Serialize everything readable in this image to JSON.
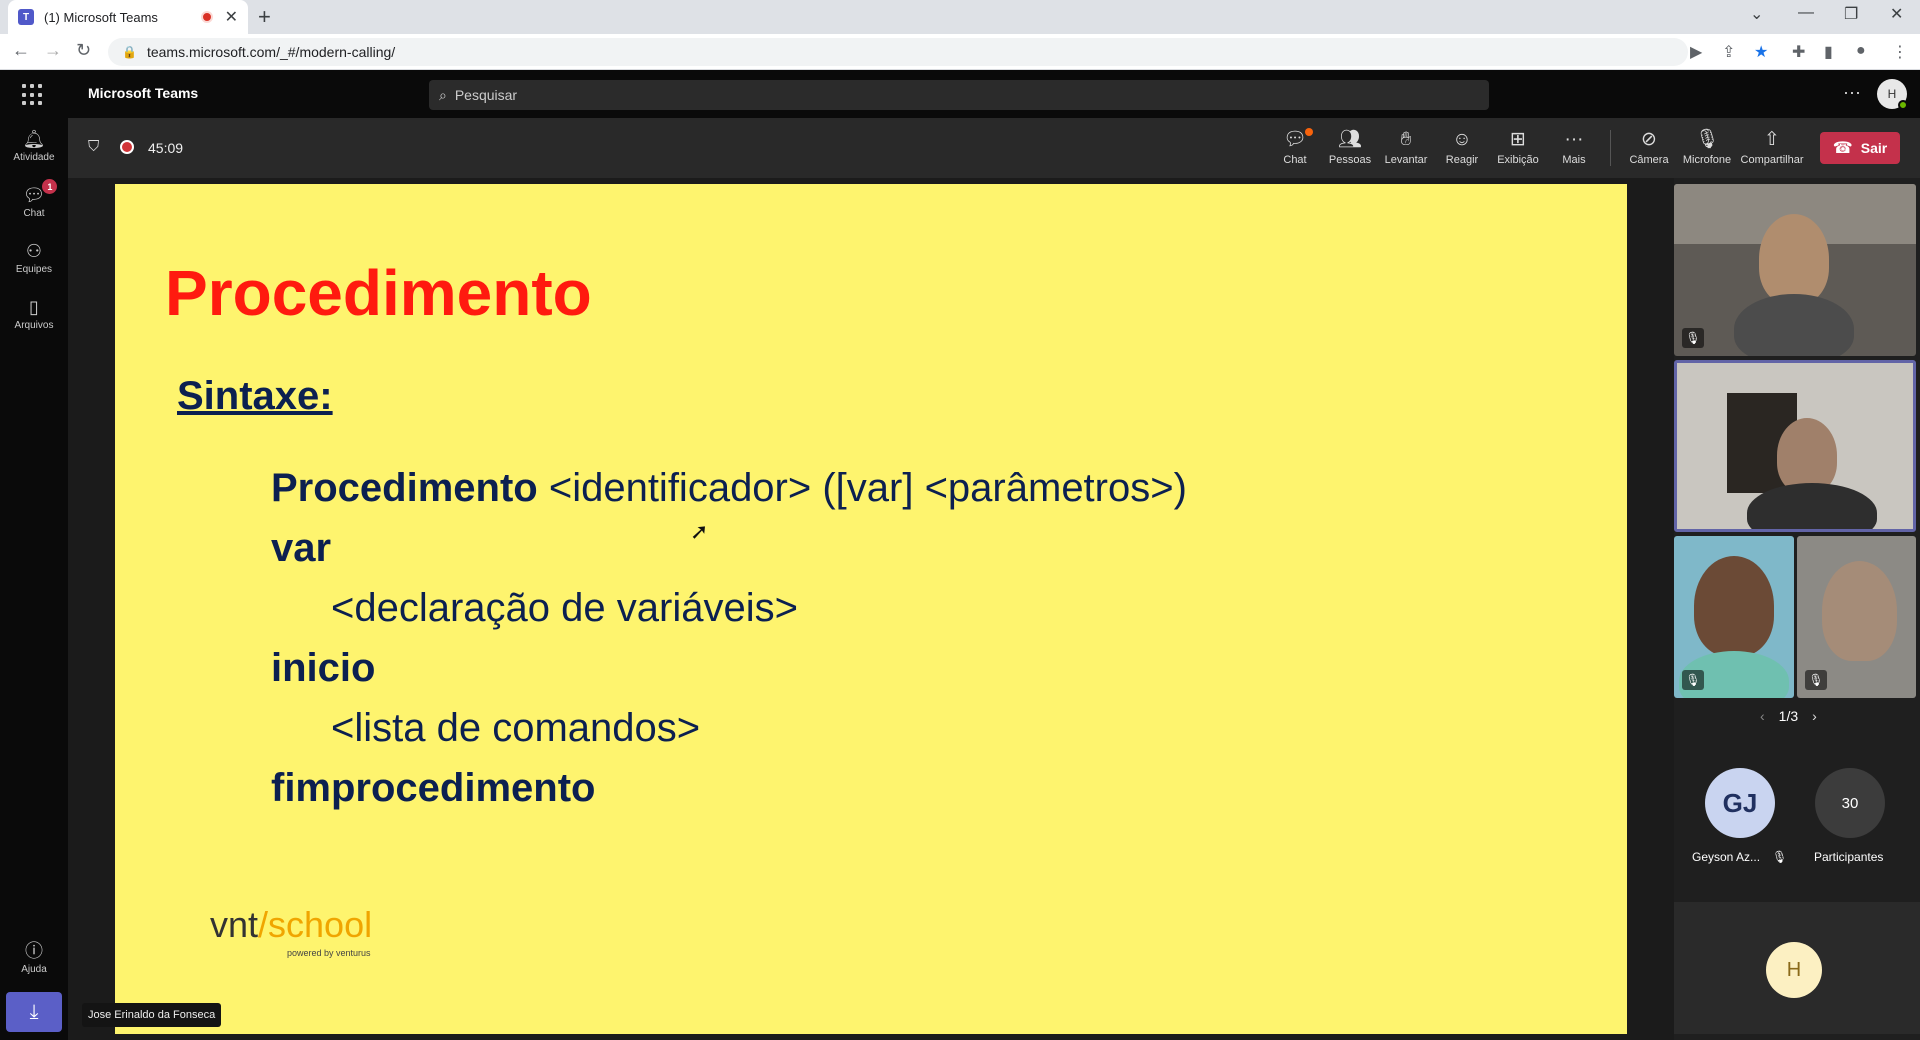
{
  "browser": {
    "tab_title": "(1) Microsoft Teams",
    "url": "teams.microsoft.com/_#/modern-calling/"
  },
  "teams": {
    "app_name": "Microsoft Teams",
    "search_placeholder": "Pesquisar",
    "user_initial": "H"
  },
  "rail": {
    "items": [
      {
        "label": "Atividade",
        "icon": "bell-icon"
      },
      {
        "label": "Chat",
        "icon": "chat-icon",
        "badge": "1"
      },
      {
        "label": "Equipes",
        "icon": "teams-icon"
      },
      {
        "label": "Arquivos",
        "icon": "file-icon"
      }
    ],
    "help_label": "Ajuda"
  },
  "meeting": {
    "timer": "45:09",
    "toolbar": {
      "chat": "Chat",
      "people": "Pessoas",
      "raise": "Levantar",
      "react": "Reagir",
      "view": "Exibição",
      "more": "Mais",
      "camera": "Câmera",
      "mic": "Microfone",
      "share": "Compartilhar",
      "leave": "Sair"
    },
    "presenter_name": "Jose Erinaldo da Fonseca"
  },
  "slide": {
    "title": "Procedimento",
    "subtitle": "Sintaxe:",
    "line1_kw": "Procedimento",
    "line1_rest": " <identificador> ([var] <parâmetros>)",
    "line2": "var",
    "line3": "<declaração de variáveis>",
    "line4": "inicio",
    "line5": "<lista de comandos>",
    "line6": "fimprocedimento",
    "logo_vnt": "vnt",
    "logo_school": "/school",
    "logo_powered": "powered by  venturus"
  },
  "participants": {
    "page": "1/3",
    "gj_initials": "GJ",
    "gj_name": "Geyson Az...",
    "count": "30",
    "count_label": "Participantes",
    "self_initial": "H"
  },
  "colors": {
    "slide_bg": "#fef46e",
    "slide_title": "#ff1a0f",
    "slide_text": "#0c2050",
    "leave": "#c4314b",
    "accent": "#5b5fc7"
  }
}
